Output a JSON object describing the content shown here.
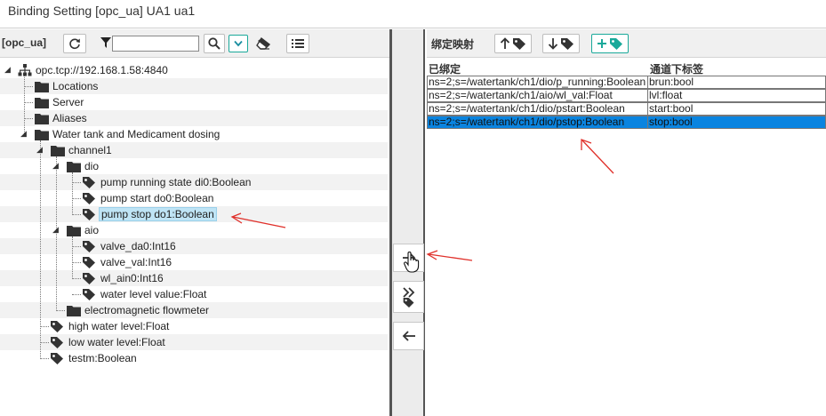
{
  "window": {
    "title": "Binding Setting [opc_ua] UA1 ua1"
  },
  "left_toolbar": {
    "source_label": "[opc_ua]",
    "filter_value": "",
    "icons": [
      "refresh-icon",
      "filter-icon",
      "search-icon",
      "dropdown-icon",
      "eraser-icon",
      "list-icon"
    ]
  },
  "tree": {
    "nodes": [
      {
        "label": "opc.tcp://192.168.1.58:4840",
        "icon": "network-icon",
        "expanded": true
      },
      {
        "label": "Locations",
        "icon": "folder-icon"
      },
      {
        "label": "Server",
        "icon": "folder-icon"
      },
      {
        "label": "Aliases",
        "icon": "folder-icon"
      },
      {
        "label": "Water tank and Medicament dosing",
        "icon": "folder-icon",
        "expanded": true
      },
      {
        "label": "channel1",
        "icon": "folder-icon",
        "expanded": true
      },
      {
        "label": "dio",
        "icon": "folder-icon",
        "expanded": true
      },
      {
        "label": "pump running state di0:Boolean",
        "icon": "tag-icon"
      },
      {
        "label": "pump start do0:Boolean",
        "icon": "tag-icon"
      },
      {
        "label": "pump stop do1:Boolean",
        "icon": "tag-icon",
        "selected": true
      },
      {
        "label": "aio",
        "icon": "folder-icon",
        "expanded": true
      },
      {
        "label": "valve_da0:Int16",
        "icon": "tag-icon"
      },
      {
        "label": "valve_val:Int16",
        "icon": "tag-icon"
      },
      {
        "label": "wl_ain0:Int16",
        "icon": "tag-icon"
      },
      {
        "label": "water level value:Float",
        "icon": "tag-icon"
      },
      {
        "label": "electromagnetic flowmeter",
        "icon": "folder-icon"
      },
      {
        "label": "high water level:Float",
        "icon": "tag-icon"
      },
      {
        "label": "low water level:Float",
        "icon": "tag-icon"
      },
      {
        "label": "testm:Boolean",
        "icon": "tag-icon"
      }
    ]
  },
  "middle_buttons": [
    {
      "name": "bind-button",
      "glyph": "→"
    },
    {
      "name": "bind-all-button",
      "glyph": "»"
    },
    {
      "name": "unbind-button",
      "glyph": "←"
    }
  ],
  "right_toolbar": {
    "caption": "绑定映射",
    "buttons": [
      "sort-up-tag-icon",
      "sort-down-tag-icon",
      "add-tag-icon"
    ]
  },
  "mapping_table": {
    "headers": [
      "已绑定",
      "通道下标签"
    ],
    "rows": [
      [
        "ns=2;s=/watertank/ch1/dio/p_running:Boolean",
        "brun:bool"
      ],
      [
        "ns=2;s=/watertank/ch1/aio/wl_val:Float",
        "lvl:float"
      ],
      [
        "ns=2;s=/watertank/ch1/dio/pstart:Boolean",
        "start:bool"
      ],
      [
        "ns=2;s=/watertank/ch1/dio/pstop:Boolean",
        "stop:bool"
      ]
    ],
    "selected_row": 3
  },
  "colors": {
    "selection_blue": "#0a84e0",
    "tree_selection": "#bfe4f5",
    "annotation_red": "#e0302a",
    "accent_green": "#1aa99a"
  }
}
